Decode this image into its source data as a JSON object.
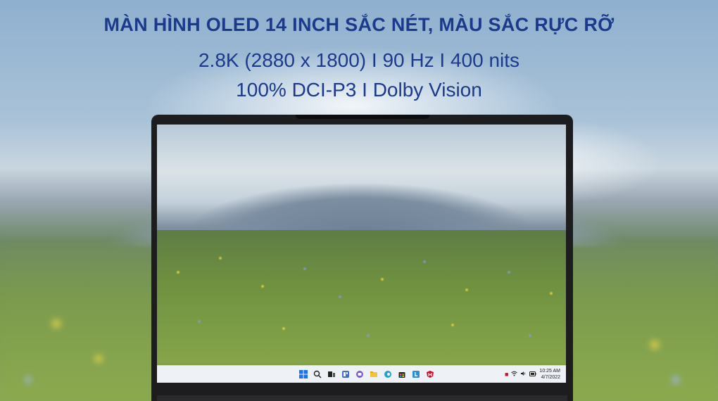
{
  "headline": "MÀN HÌNH OLED 14 INCH SẮC NÉT, MÀU SẮC RỰC RỠ",
  "specs_line1": "2.8K (2880 x 1800) I 90 Hz I 400 nits",
  "specs_line2": "100% DCI-P3 I Dolby Vision",
  "taskbar": {
    "icons": [
      "windows-start-icon",
      "search-icon",
      "task-view-icon",
      "widgets-icon",
      "chat-icon",
      "file-explorer-icon",
      "edge-icon",
      "store-icon",
      "lenovo-vantage-icon",
      "mcafee-icon"
    ],
    "tray": {
      "time": "10:25 AM",
      "date": "4/7/2022"
    }
  },
  "colors": {
    "headline": "#1b3a8c"
  }
}
